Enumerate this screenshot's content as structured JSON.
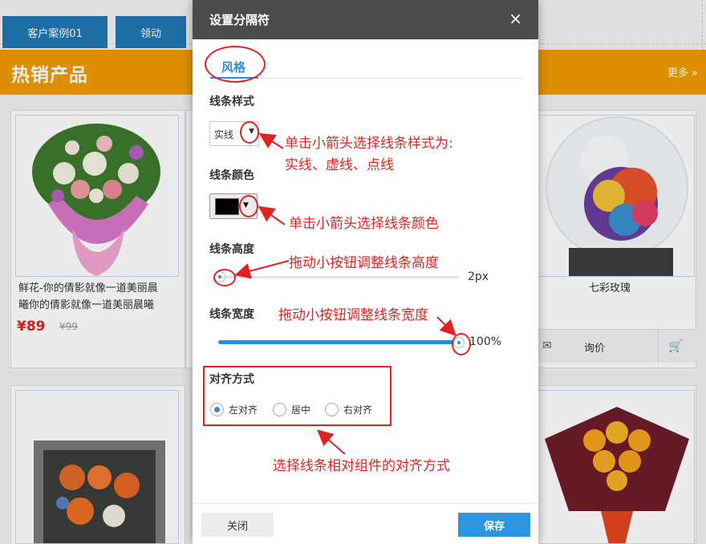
{
  "background": {
    "nav_tabs": [
      "客户案例01",
      "领动"
    ],
    "section_title": "热销产品",
    "more_link": "更多 »",
    "products": [
      {
        "name_line1": "鲜花-你的倩影就像一道美丽晨",
        "name_line2": "曦你的倩影就像一道美丽晨曦",
        "price": "¥89",
        "old_price": "¥99"
      },
      {
        "name_line1": "七彩玫瑰",
        "inquire_label": "询价"
      }
    ]
  },
  "dialog": {
    "title": "设置分隔符",
    "close_icon": "×",
    "tab_label": "风格",
    "line_style": {
      "label": "线条样式",
      "value": "实线",
      "arrow": "▼"
    },
    "line_color": {
      "label": "线条颜色",
      "value": "#000000",
      "arrow": "▼"
    },
    "line_height": {
      "label": "线条高度",
      "value_text": "2px",
      "level": 0.02
    },
    "line_width": {
      "label": "线条宽度",
      "value_text": "100%",
      "level": 1.0
    },
    "alignment": {
      "label": "对齐方式",
      "options": [
        {
          "label": "左对齐",
          "selected": true
        },
        {
          "label": "居中",
          "selected": false
        },
        {
          "label": "右对齐",
          "selected": false
        }
      ]
    },
    "close_button": "关闭",
    "save_button": "保存"
  },
  "annotations": {
    "line_style_note_1": "单击小箭头选择线条样式为:",
    "line_style_note_2": "实线、虚线、点线",
    "line_color_note": "单击小箭头选择线条颜色",
    "line_height_note": "拖动小按钮调整线条高度",
    "line_width_note": "拖动小按钮调整线条宽度",
    "alignment_note": "选择线条相对组件的对齐方式"
  },
  "colors": {
    "accent": "#2d8cd4",
    "header": "#4a4b4c",
    "annotation": "#e02222",
    "banner": "#f09c00"
  }
}
